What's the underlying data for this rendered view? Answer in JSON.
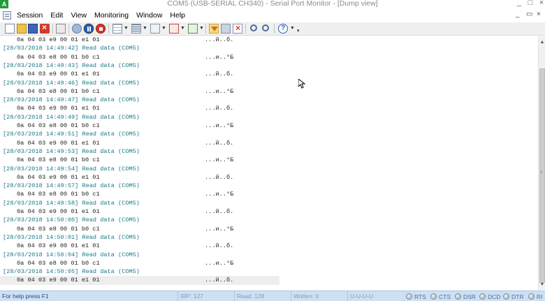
{
  "window": {
    "title": "COM5 (USB-SERIAL CH340) - Serial Port Monitor - [Dump view]",
    "minimize": "_",
    "maximize": "□",
    "close": "×",
    "mdi_minimize": "_",
    "mdi_restore": "▭",
    "mdi_close": "×"
  },
  "menu": {
    "items": [
      "Session",
      "Edit",
      "View",
      "Monitoring",
      "Window",
      "Help"
    ]
  },
  "toolbar": {
    "icons": [
      "new-file-icon",
      "open-file-icon",
      "save-icon",
      "close-session-icon",
      "copy-icon",
      "start-icon",
      "pause-icon",
      "stop-icon",
      "table-view-icon",
      "line-view-icon",
      "terminal-view-icon",
      "hex-view-icon",
      "dump-view-icon",
      "filter-icon",
      "tools-icon",
      "clear-icon",
      "find-icon",
      "find-next-icon",
      "help-icon"
    ],
    "accent": "#f3c04a"
  },
  "log": {
    "entries": [
      {
        "type": "data",
        "hex": "0a 04 03 e9 00 01 e1 01",
        "ascii": "...й..б."
      },
      {
        "type": "header",
        "text": "[28/03/2018 14:49:42] Read data (COM5)"
      },
      {
        "type": "data",
        "hex": "0a 04 03 e8 00 01 b0 c1",
        "ascii": "...и..°Б"
      },
      {
        "type": "header",
        "text": "[28/03/2018 14:49:43] Read data (COM5)"
      },
      {
        "type": "data",
        "hex": "0a 04 03 e9 00 01 e1 01",
        "ascii": "...й..б."
      },
      {
        "type": "header",
        "text": "[28/03/2018 14:49:46] Read data (COM5)"
      },
      {
        "type": "data",
        "hex": "0a 04 03 e8 00 01 b0 c1",
        "ascii": "...и..°Б"
      },
      {
        "type": "header",
        "text": "[28/03/2018 14:49:47] Read data (COM5)"
      },
      {
        "type": "data",
        "hex": "0a 04 03 e9 00 01 e1 01",
        "ascii": "...й..б."
      },
      {
        "type": "header",
        "text": "[28/03/2018 14:49:49] Read data (COM5)"
      },
      {
        "type": "data",
        "hex": "0a 04 03 e8 00 01 b0 c1",
        "ascii": "...и..°Б"
      },
      {
        "type": "header",
        "text": "[28/03/2018 14:49:51] Read data (COM5)"
      },
      {
        "type": "data",
        "hex": "0a 04 03 e9 00 01 e1 01",
        "ascii": "...й..б."
      },
      {
        "type": "header",
        "text": "[28/03/2018 14:49:53] Read data (COM5)"
      },
      {
        "type": "data",
        "hex": "0a 04 03 e8 00 01 b0 c1",
        "ascii": "...и..°Б"
      },
      {
        "type": "header",
        "text": "[28/03/2018 14:49:54] Read data (COM5)"
      },
      {
        "type": "data",
        "hex": "0a 04 03 e9 00 01 e1 01",
        "ascii": "...й..б."
      },
      {
        "type": "header",
        "text": "[28/03/2018 14:49:57] Read data (COM5)"
      },
      {
        "type": "data",
        "hex": "0a 04 03 e8 00 01 b0 c1",
        "ascii": "...и..°Б"
      },
      {
        "type": "header",
        "text": "[28/03/2018 14:49:58] Read data (COM5)"
      },
      {
        "type": "data",
        "hex": "0a 04 03 e9 00 01 e1 01",
        "ascii": "...й..б."
      },
      {
        "type": "header",
        "text": "[28/03/2018 14:50:00] Read data (COM5)"
      },
      {
        "type": "data",
        "hex": "0a 04 03 e8 00 01 b0 c1",
        "ascii": "...и..°Б"
      },
      {
        "type": "header",
        "text": "[28/03/2018 14:50:01] Read data (COM5)"
      },
      {
        "type": "data",
        "hex": "0a 04 03 e9 00 01 e1 01",
        "ascii": "...й..б."
      },
      {
        "type": "header",
        "text": "[28/03/2018 14:50:04] Read data (COM5)"
      },
      {
        "type": "data",
        "hex": "0a 04 03 e8 00 01 b0 c1",
        "ascii": "...и..°Б"
      },
      {
        "type": "header",
        "text": "[28/03/2018 14:50:05] Read data (COM5)"
      },
      {
        "type": "data",
        "hex": "0a 04 03 e9 00 01 e1 01",
        "ascii": "...й..б.",
        "selected": true
      }
    ],
    "header_color": "#1a7a88"
  },
  "statusbar": {
    "help": "For help press F1",
    "irp": "IRP: 127",
    "read": "Read: 128",
    "written": "Written: 0",
    "line_settings": "U-U-U-U",
    "signals": [
      "RTS",
      "CTS",
      "DSR",
      "DCD",
      "DTR",
      "RI"
    ],
    "background": "#cfe0f3"
  }
}
